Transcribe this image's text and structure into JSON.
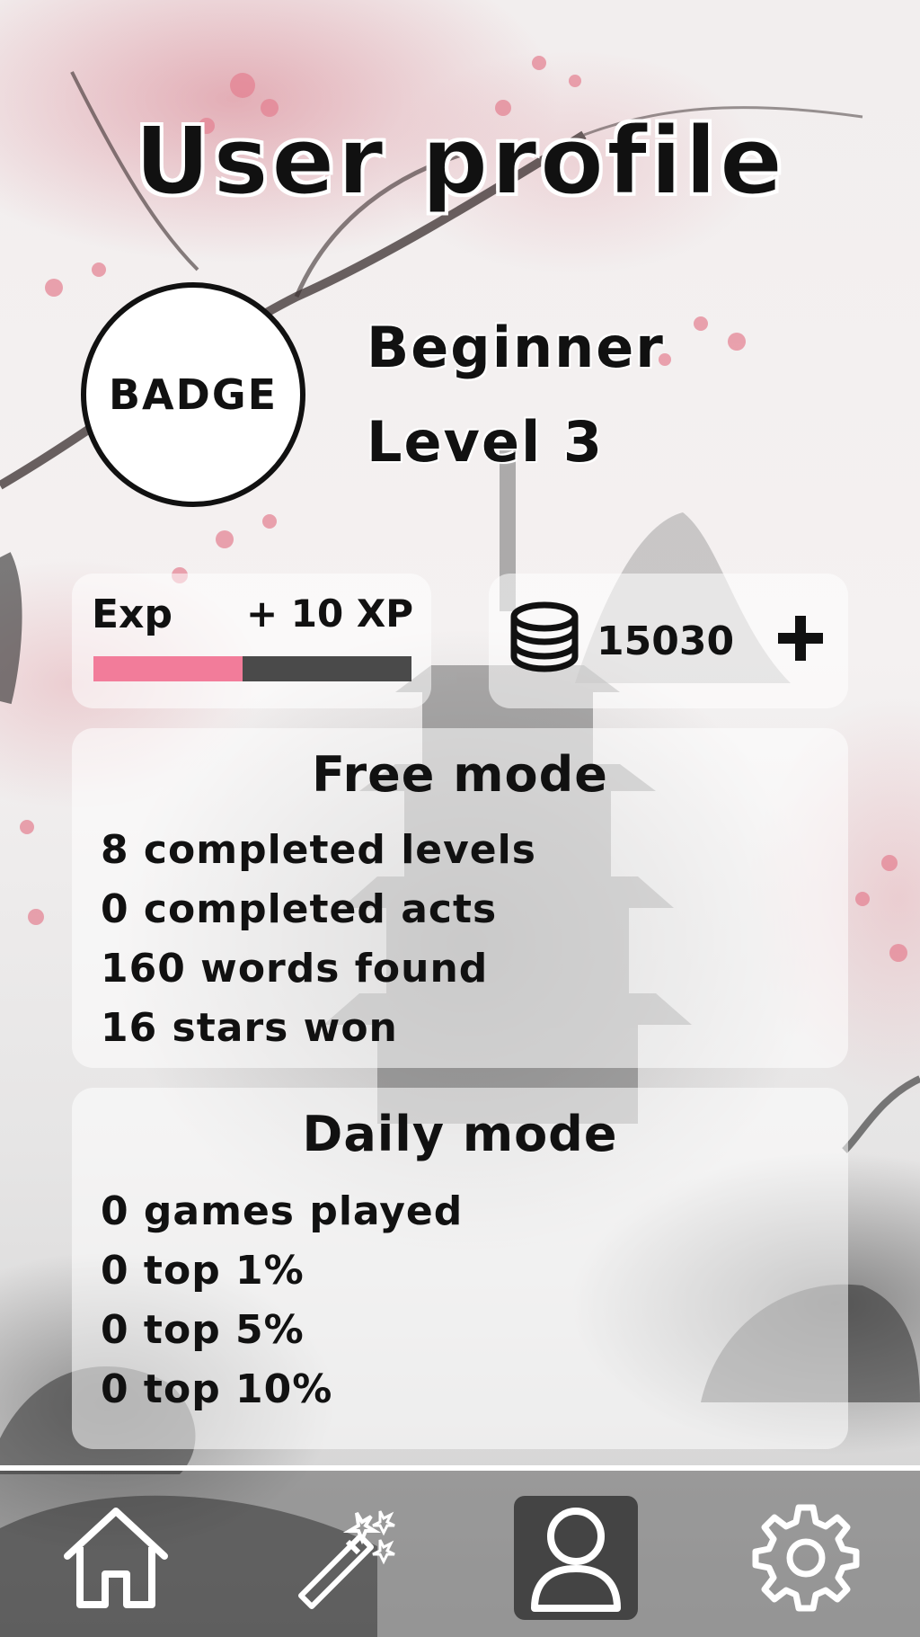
{
  "header": {
    "title": "User profile"
  },
  "profile": {
    "badge_label": "BADGE",
    "rank": "Beginner",
    "level": "Level 3"
  },
  "experience": {
    "label": "Exp",
    "gain": "+ 10 XP",
    "progress": 0.47,
    "fill_color": "#f27c9a",
    "track_color": "#4a4a4a"
  },
  "coins": {
    "icon": "coin-stack-icon",
    "value": "15030",
    "add_icon": "plus-icon"
  },
  "free_mode": {
    "title": "Free mode",
    "stats": [
      "8 completed levels",
      "0 completed acts",
      "160 words found",
      "16 stars won"
    ]
  },
  "daily_mode": {
    "title": "Daily mode",
    "stats": [
      "0 games played",
      "0 top 1%",
      "0 top 5%",
      "0 top 10%"
    ]
  },
  "nav": {
    "items": [
      {
        "icon": "home-icon",
        "active": false
      },
      {
        "icon": "magic-wand-icon",
        "active": false
      },
      {
        "icon": "user-icon",
        "active": true
      },
      {
        "icon": "gear-icon",
        "active": false
      }
    ]
  }
}
